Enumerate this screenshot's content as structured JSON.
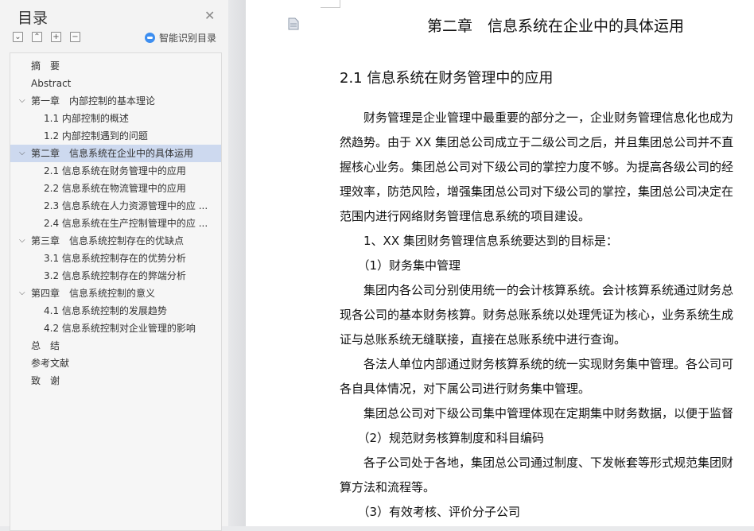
{
  "sidebar": {
    "title": "目录",
    "smart_label": "智能识别目录",
    "tools": [
      {
        "name": "collapse-all",
        "glyph": "⌄"
      },
      {
        "name": "expand-all",
        "glyph": "⌃"
      },
      {
        "name": "add-level",
        "glyph": "+"
      },
      {
        "name": "remove-level",
        "glyph": "−"
      }
    ],
    "toc": [
      {
        "label": "摘　要",
        "level": 0,
        "chevron": false
      },
      {
        "label": "Abstract",
        "level": 0,
        "chevron": false
      },
      {
        "label": "第一章　内部控制的基本理论",
        "level": 0,
        "chevron": true
      },
      {
        "label": "1.1 内部控制的概述",
        "level": 1,
        "chevron": false
      },
      {
        "label": "1.2 内部控制遇到的问题",
        "level": 1,
        "chevron": false
      },
      {
        "label": "第二章　信息系统在企业中的具体运用",
        "level": 0,
        "chevron": true,
        "selected": true
      },
      {
        "label": "2.1 信息系统在财务管理中的应用",
        "level": 1,
        "chevron": false
      },
      {
        "label": "2.2 信息系统在物流管理中的应用",
        "level": 1,
        "chevron": false
      },
      {
        "label": "2.3 信息系统在人力资源管理中的应 ...",
        "level": 1,
        "chevron": false
      },
      {
        "label": "2.4 信息系统在生产控制管理中的应 ...",
        "level": 1,
        "chevron": false
      },
      {
        "label": "第三章　信息系统控制存在的优缺点",
        "level": 0,
        "chevron": true
      },
      {
        "label": "3.1 信息系统控制存在的优势分析",
        "level": 1,
        "chevron": false
      },
      {
        "label": "3.2 信息系统控制存在的弊端分析",
        "level": 1,
        "chevron": false
      },
      {
        "label": "第四章　信息系统控制的意义",
        "level": 0,
        "chevron": true
      },
      {
        "label": "4.1 信息系统控制的发展趋势",
        "level": 1,
        "chevron": false
      },
      {
        "label": "4.2 信息系统控制对企业管理的影响",
        "level": 1,
        "chevron": false
      },
      {
        "label": "总　结",
        "level": 0,
        "chevron": false
      },
      {
        "label": "参考文献",
        "level": 0,
        "chevron": false
      },
      {
        "label": "致　谢",
        "level": 0,
        "chevron": false
      }
    ]
  },
  "document": {
    "chapter_title": "第二章　信息系统在企业中的具体运用",
    "section_title": "2.1 信息系统在财务管理中的应用",
    "lines": [
      "　　财务管理是企业管理中最重要的部分之一，企业财务管理信息化也成为",
      "然趋势。由于 XX 集团总公司成立于二级公司之后，并且集团总公司并不直",
      "握核心业务。集团总公司对下级公司的掌控力度不够。为提高各级公司的经",
      "理效率，防范风险，增强集团总公司对下级公司的掌控，集团总公司决定在",
      "范围内进行网络财务管理信息系统的项目建设。",
      "　　1、XX 集团财务管理信息系统要达到的目标是：",
      "　　（1）财务集中管理",
      "　　集团内各公司分别使用统一的会计核算系统。会计核算系统通过财务总",
      "现各公司的基本财务核算。财务总账系统以处理凭证为核心，业务系统生成",
      "证与总账系统无缝联接，直接在总账系统中进行查询。",
      "　　各法人单位内部通过财务核算系统的统一实现财务集中管理。各公司可",
      "各自具体情况，对下属公司进行财务集中管理。",
      "　　集团总公司对下级公司集中管理体现在定期集中财务数据，以便于监督",
      "　　（2）规范财务核算制度和科目编码",
      "　　各子公司处于各地，集团总公司通过制度、下发帐套等形式规范集团财",
      "算方法和流程等。",
      "　　（3）有效考核、评价分子公司"
    ]
  }
}
